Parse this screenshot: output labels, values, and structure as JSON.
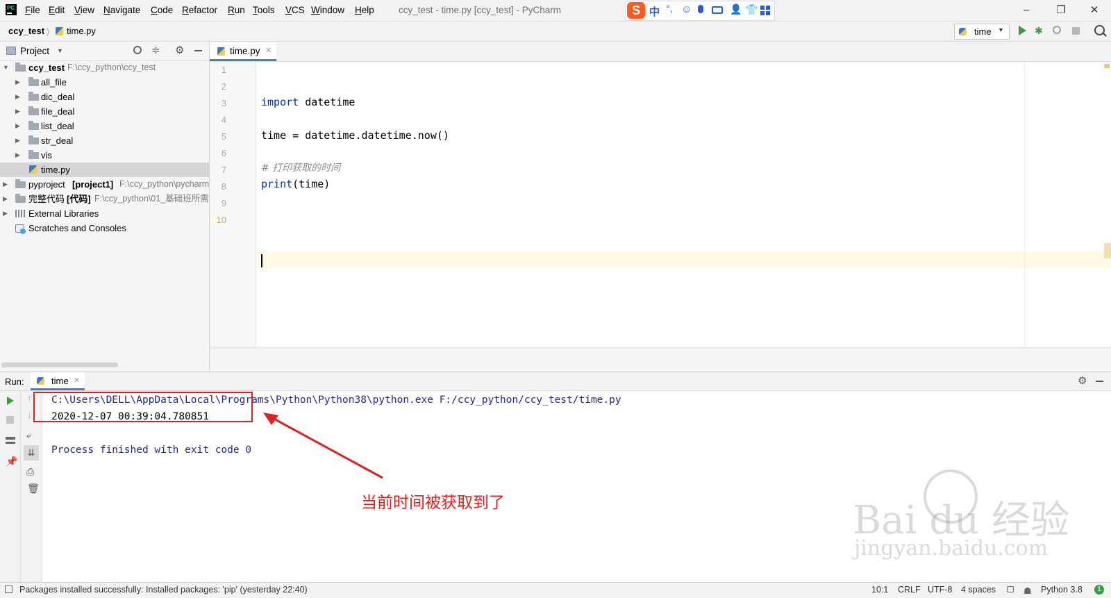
{
  "titlebar": {
    "menu": [
      "File",
      "Edit",
      "View",
      "Navigate",
      "Code",
      "Refactor",
      "Run",
      "Tools",
      "VCS",
      "Window",
      "Help"
    ],
    "window_title": "ccy_test - time.py [ccy_test] - PyCharm",
    "ime_label": "中",
    "minimize": "–",
    "restore": "❐",
    "close": "✕"
  },
  "navbar": {
    "crumbs": [
      "ccy_test",
      "time.py"
    ],
    "run_config": "time"
  },
  "project": {
    "header_label": "Project",
    "root": {
      "name": "ccy_test",
      "path": "F:\\ccy_python\\ccy_test"
    },
    "folders": [
      "all_file",
      "dic_deal",
      "file_deal",
      "list_deal",
      "str_deal",
      "vis"
    ],
    "selected_file": "time.py",
    "other_roots": [
      {
        "name": "pyproject",
        "tag": "[project1]",
        "path": "F:\\ccy_python\\pycharm"
      },
      {
        "name": "完整代码",
        "tag": "[代码]",
        "path": "F:\\ccy_python\\01_基础班所需"
      }
    ],
    "external_libraries": "External Libraries",
    "scratches": "Scratches and Consoles"
  },
  "editor": {
    "tab_label": "time.py",
    "line_numbers": [
      "1",
      "2",
      "3",
      "4",
      "5",
      "6",
      "7",
      "8",
      "9",
      "10"
    ],
    "code": {
      "l3_kw": "import",
      "l3_rest": " datetime",
      "l5": "time = datetime.datetime.now()",
      "l7": "# 打印获取的时间",
      "l8_kw": "print",
      "l8_rest": "(time)"
    }
  },
  "run": {
    "label": "Run:",
    "tab_label": "time",
    "cmd": "C:\\Users\\DELL\\AppData\\Local\\Programs\\Python\\Python38\\python.exe F:/ccy_python/ccy_test/time.py",
    "output": "2020-12-07 00:39:04.780851",
    "finished": "Process finished with exit code 0",
    "annotation": "当前时间被获取到了"
  },
  "watermark": {
    "brand": "Bai du 经验",
    "url": "jingyan.baidu.com"
  },
  "statusbar": {
    "message": "Packages installed successfully: Installed packages: 'pip' (yesterday 22:40)",
    "position": "10:1",
    "line_sep": "CRLF",
    "encoding": "UTF-8",
    "indent": "4 spaces",
    "interpreter": "Python 3.8",
    "event_count": "1"
  },
  "colors": {
    "accent": "#4083c9",
    "keyword": "#0033b3",
    "annotation_red": "#e02020",
    "run_green": "#3c9b3c"
  }
}
